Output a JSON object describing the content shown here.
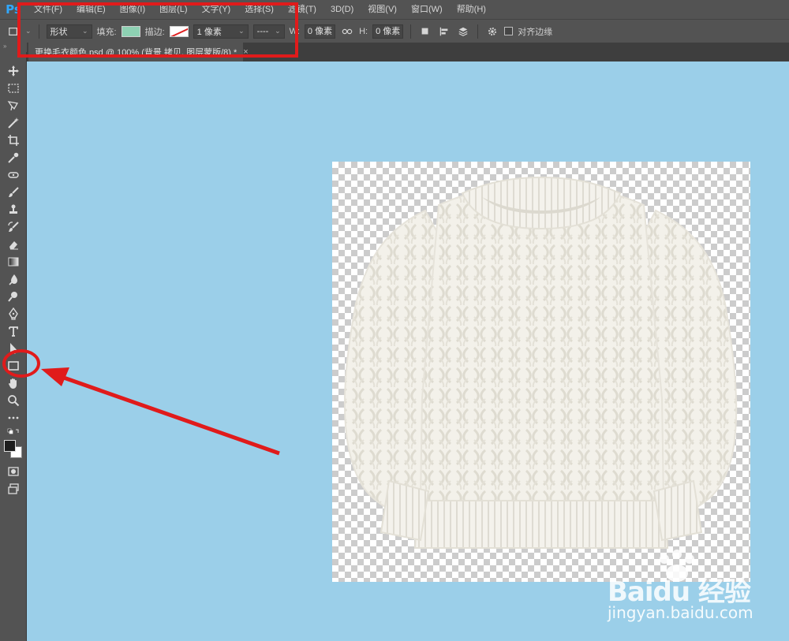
{
  "app": {
    "logo": "Ps"
  },
  "menu": {
    "items": [
      "文件(F)",
      "编辑(E)",
      "图像(I)",
      "图层(L)",
      "文字(Y)",
      "选择(S)",
      "滤镜(T)",
      "3D(D)",
      "视图(V)",
      "窗口(W)",
      "帮助(H)"
    ]
  },
  "options": {
    "mode_value": "形状",
    "fill_label": "填充:",
    "fill_color": "#8ed1b3",
    "stroke_label": "描边:",
    "stroke_width_value": "1 像素",
    "stroke_style_value": "----",
    "w_label": "W:",
    "w_value": "0 像素",
    "h_label": "H:",
    "h_value": "0 像素",
    "align_edges_label": "对齐边缘"
  },
  "document": {
    "tab_title": "更换毛衣颜色.psd @ 100% (背景 拷贝, 图层蒙版/8) *",
    "tab_close": "×"
  },
  "canvas": {
    "background_color": "#9bcfe9"
  },
  "annotations": {
    "highlight_color": "#e01b1b"
  },
  "watermark": {
    "brand": "Baidu 经验",
    "url": "jingyan.baidu.com"
  }
}
